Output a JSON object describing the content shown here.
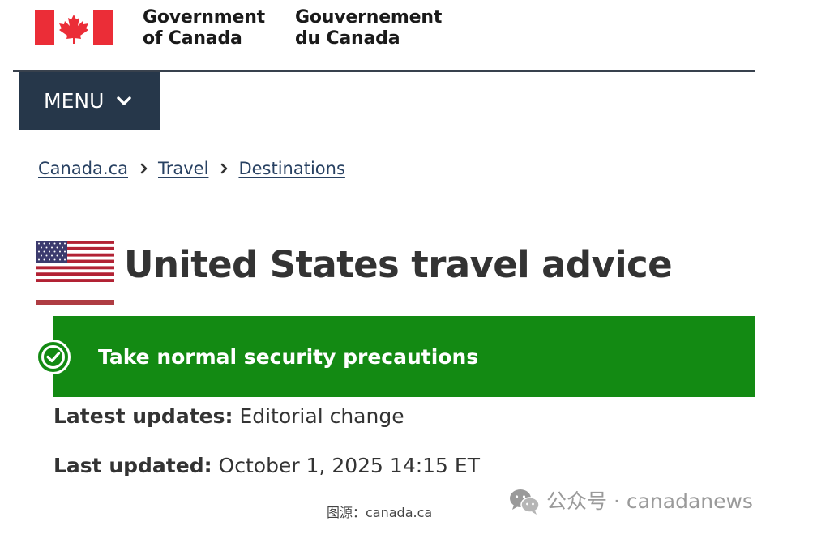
{
  "header": {
    "signature_en": [
      "Government",
      "of Canada"
    ],
    "signature_fr": [
      "Gouvernement",
      "du Canada"
    ],
    "flag_icon": "canada-flag-icon"
  },
  "menu": {
    "label": "MENU",
    "icon": "chevron-down-icon"
  },
  "breadcrumb": [
    {
      "label": "Canada.ca"
    },
    {
      "label": "Travel"
    },
    {
      "label": "Destinations"
    }
  ],
  "page": {
    "title": "United States travel advice",
    "flag_icon": "us-flag-icon"
  },
  "advisory": {
    "level_text": "Take normal security precautions",
    "icon": "check-circle-icon",
    "color": "#138a13"
  },
  "updates": {
    "latest_label": "Latest updates:",
    "latest_value": "Editorial change",
    "last_updated_label": "Last updated:",
    "last_updated_value": "October 1, 2025 14:15 ET"
  },
  "watermark": {
    "text": "公众号 · canadanews",
    "icon": "wechat-icon"
  },
  "source_note": "图源：canada.ca",
  "colors": {
    "menu_bg": "#26374a",
    "link": "#284162",
    "title_rule": "#af3c43",
    "canada_red": "#eb2d37"
  }
}
